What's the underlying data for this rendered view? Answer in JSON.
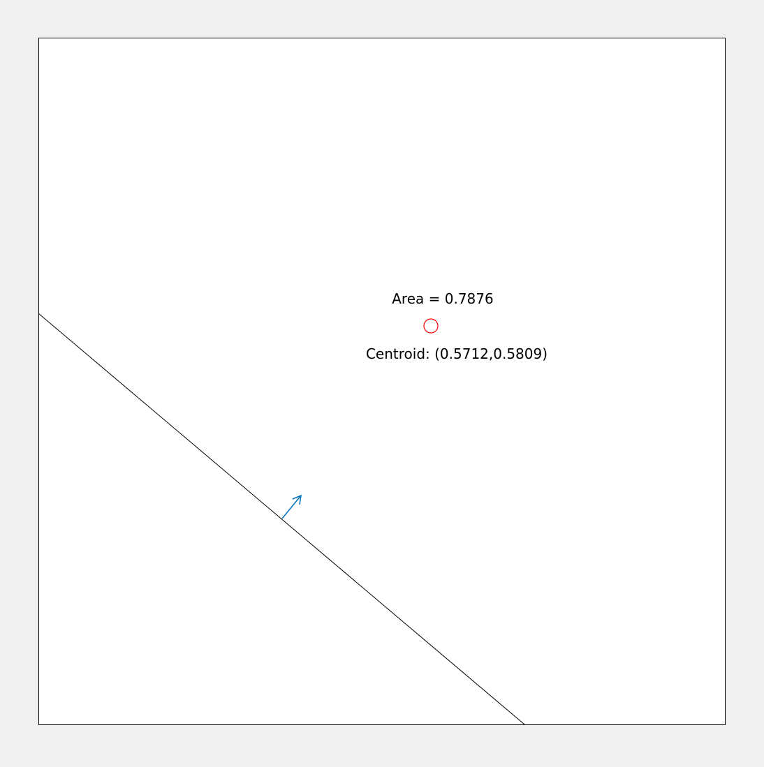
{
  "area_label": "Area = 0.7876",
  "centroid_label": "Centroid: (0.5712,0.5809)",
  "colors": {
    "figure_background": "#f0f0f0",
    "axes_background": "#ffffff",
    "axes_border": "#000000",
    "boundary_line": "#000000",
    "normal_arrow": "#0072bd",
    "centroid_marker": "#ff0000",
    "text": "#000000"
  }
}
